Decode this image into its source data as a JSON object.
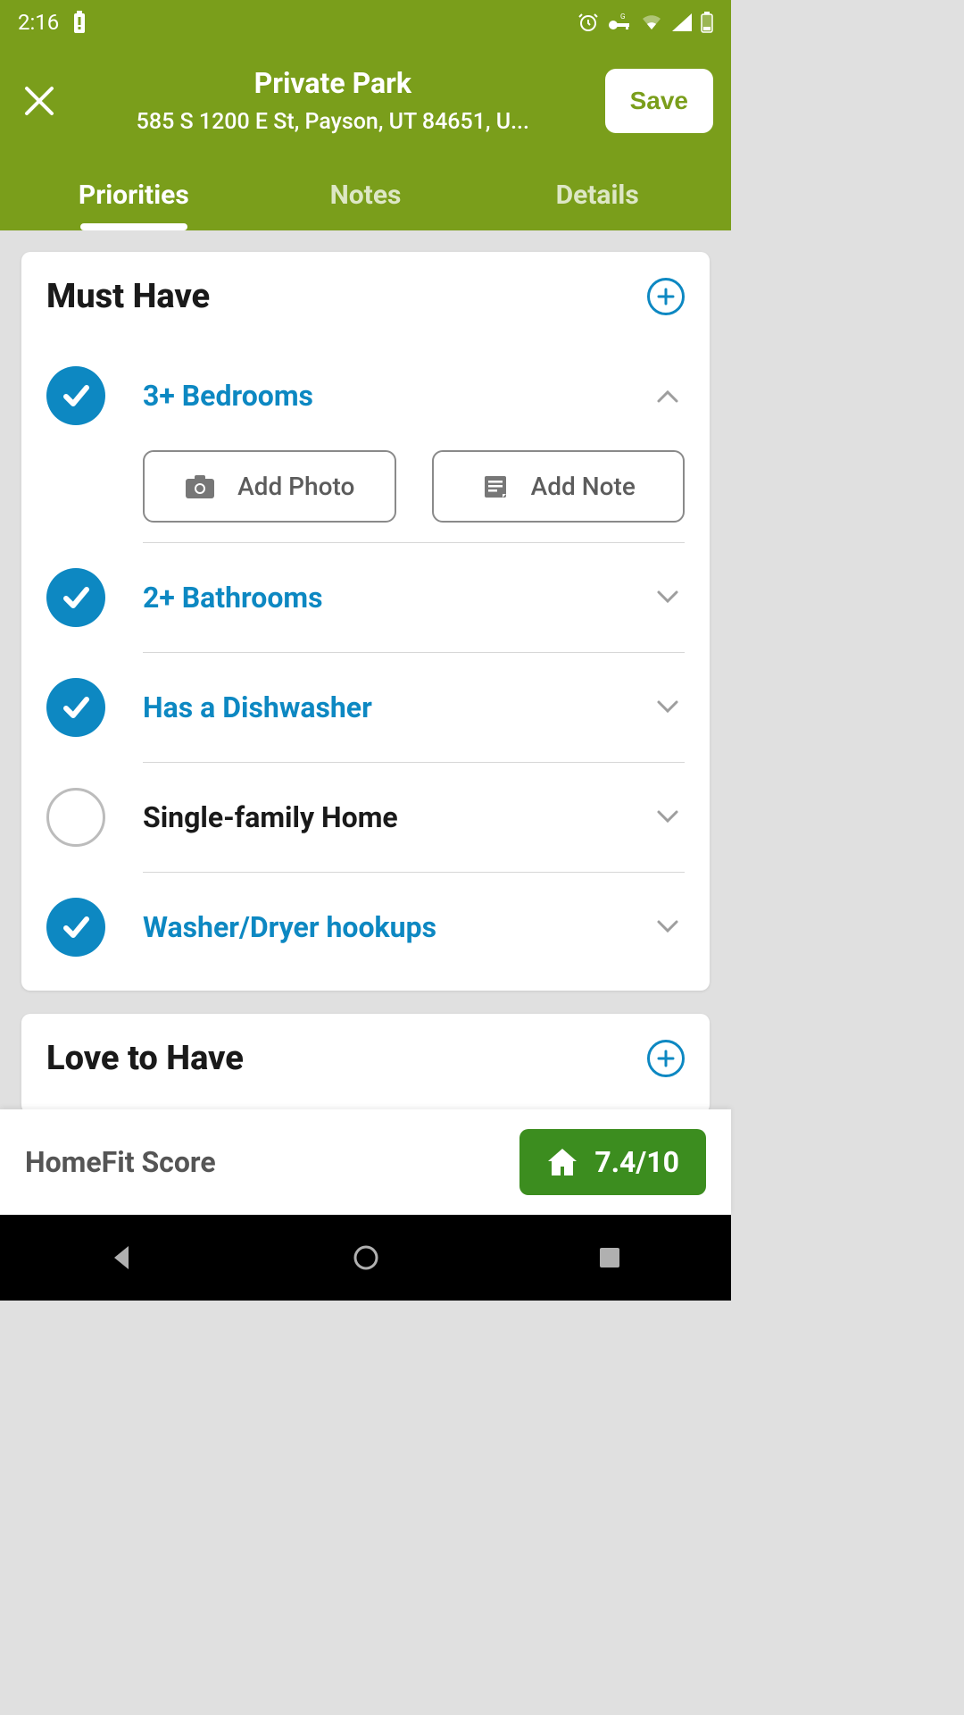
{
  "status": {
    "time": "2:16"
  },
  "header": {
    "title": "Private Park",
    "subtitle": "585 S 1200 E St, Payson, UT 84651, U...",
    "save_label": "Save"
  },
  "tabs": [
    {
      "label": "Priorities",
      "active": true
    },
    {
      "label": "Notes",
      "active": false
    },
    {
      "label": "Details",
      "active": false
    }
  ],
  "sections": [
    {
      "title": "Must Have",
      "items": [
        {
          "label": "3+ Bedrooms",
          "checked": true,
          "expanded": true
        },
        {
          "label": "2+ Bathrooms",
          "checked": true,
          "expanded": false
        },
        {
          "label": "Has a Dishwasher",
          "checked": true,
          "expanded": false
        },
        {
          "label": "Single-family Home",
          "checked": false,
          "expanded": false
        },
        {
          "label": "Washer/Dryer hookups",
          "checked": true,
          "expanded": false
        }
      ]
    },
    {
      "title": "Love to Have",
      "items": []
    }
  ],
  "sub_actions": {
    "add_photo": "Add Photo",
    "add_note": "Add Note"
  },
  "score": {
    "label": "HomeFit Score",
    "value": "7.4/10"
  },
  "colors": {
    "header_bg": "#7a9e1b",
    "accent_blue": "#0d88c2",
    "score_green": "#3c8d1f"
  }
}
